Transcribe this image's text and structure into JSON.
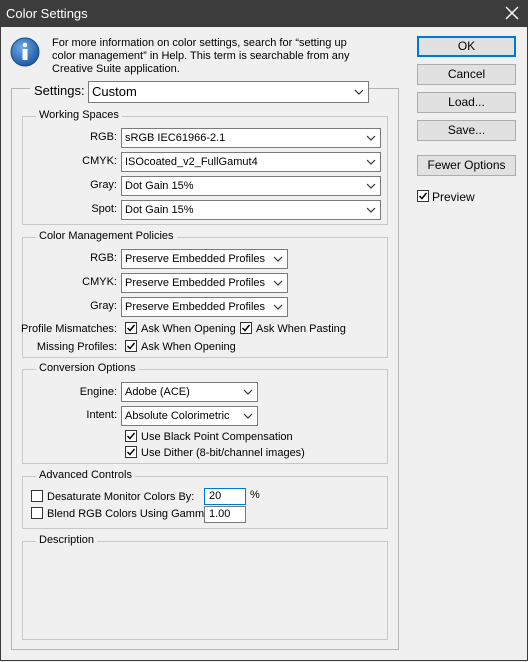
{
  "window": {
    "title": "Color Settings"
  },
  "info": {
    "text_line1": "For more information on color settings, search for “setting up",
    "text_line2": "color management” in Help. This term is searchable from any",
    "text_line3": "Creative Suite application."
  },
  "settings": {
    "label": "Settings:",
    "value": "Custom"
  },
  "working_spaces": {
    "title": "Working Spaces",
    "rgb_label": "RGB:",
    "rgb_value": "sRGB IEC61966-2.1",
    "cmyk_label": "CMYK:",
    "cmyk_value": "ISOcoated_v2_FullGamut4",
    "gray_label": "Gray:",
    "gray_value": "Dot Gain 15%",
    "spot_label": "Spot:",
    "spot_value": "Dot Gain 15%"
  },
  "policies": {
    "title": "Color Management Policies",
    "rgb_label": "RGB:",
    "rgb_value": "Preserve Embedded Profiles",
    "cmyk_label": "CMYK:",
    "cmyk_value": "Preserve Embedded Profiles",
    "gray_label": "Gray:",
    "gray_value": "Preserve Embedded Profiles",
    "mismatch_label": "Profile Mismatches:",
    "ask_opening": "Ask When Opening",
    "ask_pasting": "Ask When Pasting",
    "missing_label": "Missing Profiles:",
    "missing_ask_opening": "Ask When Opening"
  },
  "conversion": {
    "title": "Conversion Options",
    "engine_label": "Engine:",
    "engine_value": "Adobe (ACE)",
    "intent_label": "Intent:",
    "intent_value": "Absolute Colorimetric",
    "bpc_label": "Use Black Point Compensation",
    "dither_label": "Use Dither (8-bit/channel images)"
  },
  "advanced": {
    "title": "Advanced Controls",
    "desaturate_label": "Desaturate Monitor Colors By:",
    "desaturate_value": "20",
    "desaturate_unit": "%",
    "blend_label": "Blend RGB Colors Using Gamma:",
    "blend_value": "1.00"
  },
  "description": {
    "title": "Description"
  },
  "buttons": {
    "ok": "OK",
    "cancel": "Cancel",
    "load": "Load...",
    "save": "Save...",
    "fewer": "Fewer Options"
  },
  "preview": {
    "label": "Preview"
  },
  "icons": {
    "info": "info-icon",
    "close": "close-icon",
    "chevron": "chevron-down-icon",
    "check": "checkmark-icon"
  },
  "colors": {
    "titlebar": "#3c3c3c",
    "default_button_border": "#0078d7",
    "info_blue": "#1f5aa6"
  }
}
